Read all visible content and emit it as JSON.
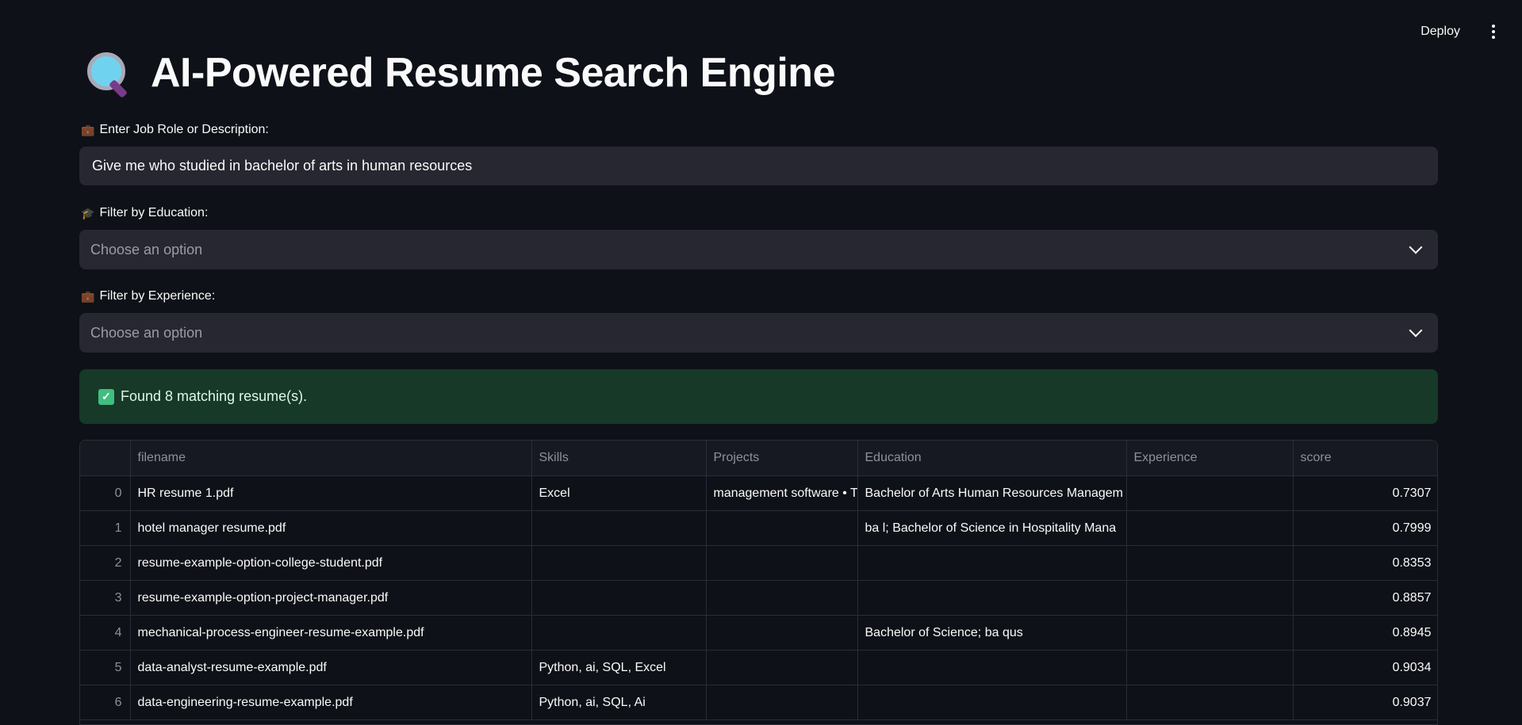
{
  "header": {
    "deploy_label": "Deploy",
    "menu_icon": "kebab-menu-icon"
  },
  "page": {
    "title": "AI-Powered Resume Search Engine",
    "title_icon": "magnifying-glass-icon"
  },
  "job_input": {
    "label": "Enter Job Role or Description:",
    "label_icon": "briefcase-icon",
    "value": "Give me who studied in bachelor of arts in human resources"
  },
  "education_filter": {
    "label": "Filter by Education:",
    "label_icon": "graduation-cap-icon",
    "placeholder": "Choose an option"
  },
  "experience_filter": {
    "label": "Filter by Experience:",
    "label_icon": "briefcase-icon",
    "placeholder": "Choose an option"
  },
  "status": {
    "message": "Found 8 matching resume(s).",
    "icon": "check-box-icon"
  },
  "table": {
    "columns": [
      "",
      "filename",
      "Skills",
      "Projects",
      "Education",
      "Experience",
      "score"
    ],
    "rows": [
      {
        "index": "0",
        "filename": "HR resume 1.pdf",
        "skills": "Excel",
        "projects": "management software • T",
        "education": "Bachelor  of Arts Human Resources Managem",
        "experience": "",
        "score": "0.7307"
      },
      {
        "index": "1",
        "filename": "hotel manager resume.pdf",
        "skills": "",
        "projects": "",
        "education": "ba  l; Bachelor  of Science in Hospitality Mana",
        "experience": "",
        "score": "0.7999"
      },
      {
        "index": "2",
        "filename": "resume-example-option-college-student.pdf",
        "skills": "",
        "projects": "",
        "education": "",
        "experience": "",
        "score": "0.8353"
      },
      {
        "index": "3",
        "filename": "resume-example-option-project-manager.pdf",
        "skills": "",
        "projects": "",
        "education": "",
        "experience": "",
        "score": "0.8857"
      },
      {
        "index": "4",
        "filename": "mechanical-process-engineer-resume-example.pdf",
        "skills": "",
        "projects": "",
        "education": "Bachelor  of Science; ba  qus",
        "experience": "",
        "score": "0.8945"
      },
      {
        "index": "5",
        "filename": "data-analyst-resume-example.pdf",
        "skills": "Python, ai, SQL, Excel",
        "projects": "",
        "education": "",
        "experience": "",
        "score": "0.9034"
      },
      {
        "index": "6",
        "filename": "data-engineering-resume-example.pdf",
        "skills": "Python, ai, SQL, Ai",
        "projects": "",
        "education": "",
        "experience": "",
        "score": "0.9037"
      }
    ]
  }
}
